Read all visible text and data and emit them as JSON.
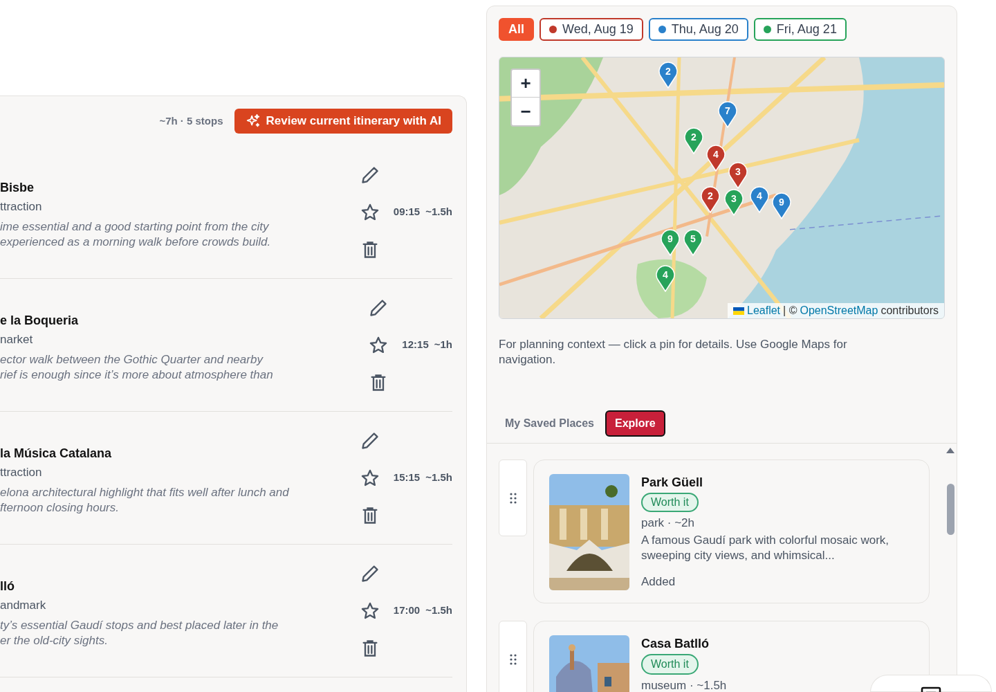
{
  "itinerary": {
    "summary": "~7h · 5 stops",
    "review_button": "Review current itinerary with AI",
    "stops": [
      {
        "title": "Bisbe",
        "category": "ttraction",
        "description_lines": [
          "ime essential and a good starting point from the city",
          "experienced as a morning walk before crowds build."
        ],
        "time": "09:15",
        "duration": "~1.5h",
        "starred": false
      },
      {
        "title": "e la Boqueria",
        "category": "narket",
        "description_lines": [
          "ector walk between the Gothic Quarter and nearby",
          "rief is enough since it’s more about atmosphere than"
        ],
        "time": "12:15",
        "duration": "~1h",
        "starred": false
      },
      {
        "title": " la Música Catalana",
        "category": "ttraction",
        "description_lines": [
          "elona architectural highlight that fits well after lunch and",
          "fternoon closing hours."
        ],
        "time": "15:15",
        "duration": "~1.5h",
        "starred": false
      },
      {
        "title": "lló",
        "category": "andmark",
        "description_lines": [
          "ty’s essential Gaudí stops and best placed later in the",
          "er the old-city sights."
        ],
        "time": "17:00",
        "duration": "~1.5h",
        "starred": false
      }
    ]
  },
  "map_panel": {
    "filters": [
      {
        "label": "All",
        "selected": true,
        "color": "#f0522e"
      },
      {
        "label": "Wed, Aug 19",
        "selected": false,
        "color": "#c0392b"
      },
      {
        "label": "Thu, Aug 20",
        "selected": false,
        "color": "#2a81cb"
      },
      {
        "label": "Fri, Aug 21",
        "selected": false,
        "color": "#27a35a"
      }
    ],
    "map": {
      "zoom_in": "+",
      "zoom_out": "−",
      "pins": [
        {
          "label": "2",
          "color": "#2a81cb"
        },
        {
          "label": "7",
          "color": "#2a81cb"
        },
        {
          "label": "2",
          "color": "#27a35a"
        },
        {
          "label": "4",
          "color": "#c0392b"
        },
        {
          "label": "3",
          "color": "#c0392b"
        },
        {
          "label": "2",
          "color": "#c0392b"
        },
        {
          "label": "3",
          "color": "#27a35a"
        },
        {
          "label": "4",
          "color": "#2a81cb"
        },
        {
          "label": "9",
          "color": "#2a81cb"
        },
        {
          "label": "9",
          "color": "#27a35a"
        },
        {
          "label": "5",
          "color": "#27a35a"
        },
        {
          "label": "4",
          "color": "#27a35a"
        }
      ],
      "attribution": {
        "leaflet": "Leaflet",
        "separator": "| ©",
        "osm": "OpenStreetMap",
        "suffix": "contributors"
      }
    },
    "caption": "For planning context — click a pin for details. Use Google Maps for navigation.",
    "tabs": [
      {
        "label": "My Saved Places",
        "selected": false
      },
      {
        "label": "Explore",
        "selected": true
      }
    ],
    "places": [
      {
        "name": "Park Güell",
        "badge": "Worth it",
        "meta": "park · ~2h",
        "description": "A famous Gaudí park with colorful mosaic work, sweeping city views, and whimsical...",
        "status": "Added"
      },
      {
        "name": "Casa Batlló",
        "badge": "Worth it",
        "meta": "museum · ~1.5h"
      }
    ]
  }
}
